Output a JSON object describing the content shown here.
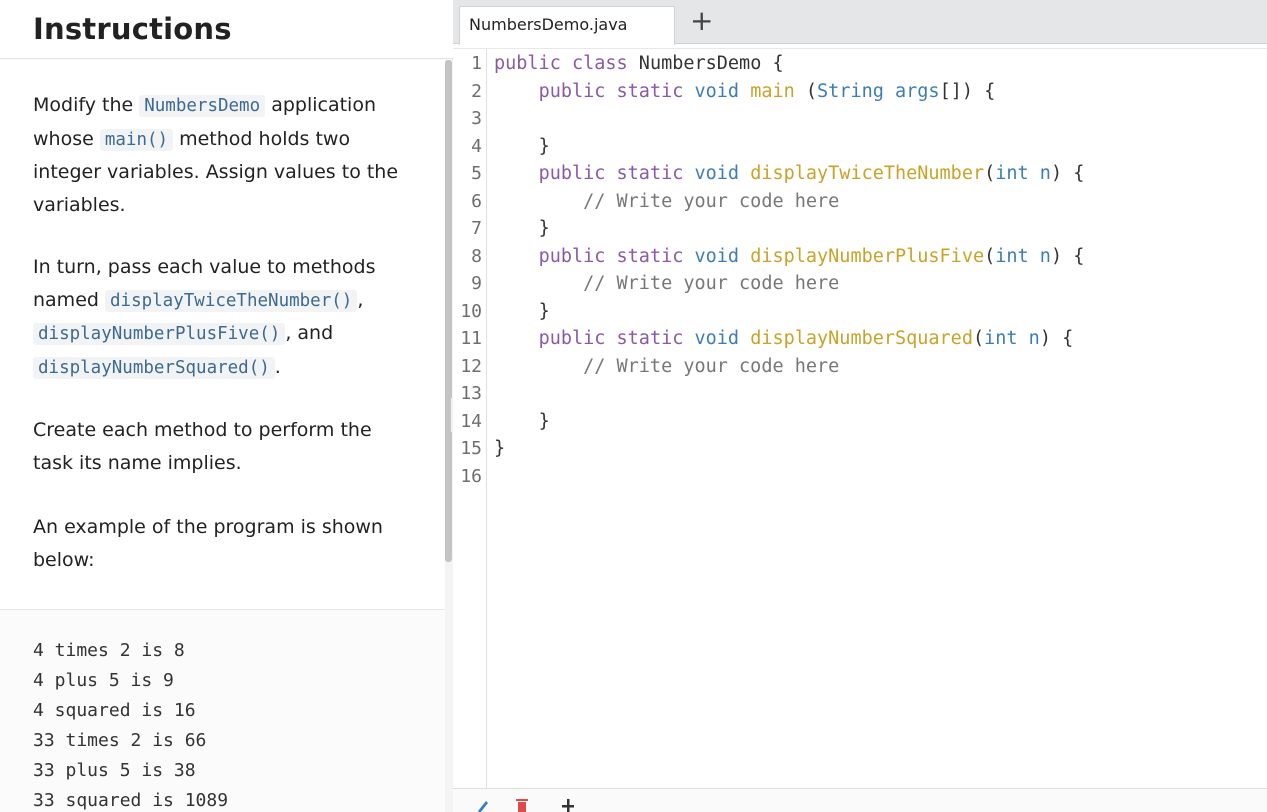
{
  "instructions": {
    "title": "Instructions",
    "p1_a": "Modify the",
    "p1_code1": "NumbersDemo",
    "p1_b": "application whose",
    "p1_code2": "main()",
    "p1_c": "method holds two integer variables. Assign values to the variables.",
    "p2_a": "In turn, pass each value to methods named",
    "p2_code1": "displayTwiceTheNumber()",
    "p2_b": ",",
    "p2_code2": "displayNumberPlusFive()",
    "p2_c": ", and",
    "p2_code3": "displayNumberSquared()",
    "p2_d": ".",
    "p3": "Create each method to perform the task its name implies.",
    "p4": "An example of the program is shown below:",
    "output": [
      "4 times 2 is 8",
      "4 plus 5 is 9",
      "4 squared is 16",
      "33 times 2 is 66",
      "33 plus 5 is 38",
      "33 squared is 1089"
    ]
  },
  "editor": {
    "tab_name": "NumbersDemo.java",
    "add_tab": "+",
    "line_numbers": [
      "1",
      "2",
      "3",
      "4",
      "5",
      "6",
      "7",
      "8",
      "9",
      "10",
      "11",
      "12",
      "13",
      "14",
      "15",
      "16"
    ],
    "code": {
      "l1_k1": "public",
      "l1_k2": "class",
      "l1_rest": " NumbersDemo {",
      "l2_k1": "public",
      "l2_k2": "static",
      "l2_k3": "void",
      "l2_f": "main",
      "l2_p1": " (",
      "l2_t": "String",
      "l2_p2": " ",
      "l2_a": "args",
      "l2_p3": "[]) {",
      "l4": "}",
      "l5_k1": "public",
      "l5_k2": "static",
      "l5_k3": "void",
      "l5_f": "displayTwiceTheNumber",
      "l5_p1": "(",
      "l5_t": "int",
      "l5_a": " n",
      "l5_p2": ") {",
      "l6": "// Write your code here",
      "l7": "}",
      "l8_k1": "public",
      "l8_k2": "static",
      "l8_k3": "void",
      "l8_f": "displayNumberPlusFive",
      "l8_p1": "(",
      "l8_t": "int",
      "l8_a": " n",
      "l8_p2": ") {",
      "l9": "// Write your code here",
      "l10": "}",
      "l11_k1": "public",
      "l11_k2": "static",
      "l11_k3": "void",
      "l11_f": "displayNumberSquared",
      "l11_p1": "(",
      "l11_t": "int",
      "l11_a": " n",
      "l11_p2": ") {",
      "l12": "// Write your code here",
      "l14": "}",
      "l15": "}"
    }
  },
  "toolbar": {
    "icons": [
      "pencil-icon",
      "trash-icon",
      "plus-icon"
    ]
  },
  "colors": {
    "keyword": "#8a5aa8",
    "type": "#3d7db5",
    "function": "#c9a227",
    "comment": "#777777",
    "inline_code": "#3d6a8f"
  }
}
